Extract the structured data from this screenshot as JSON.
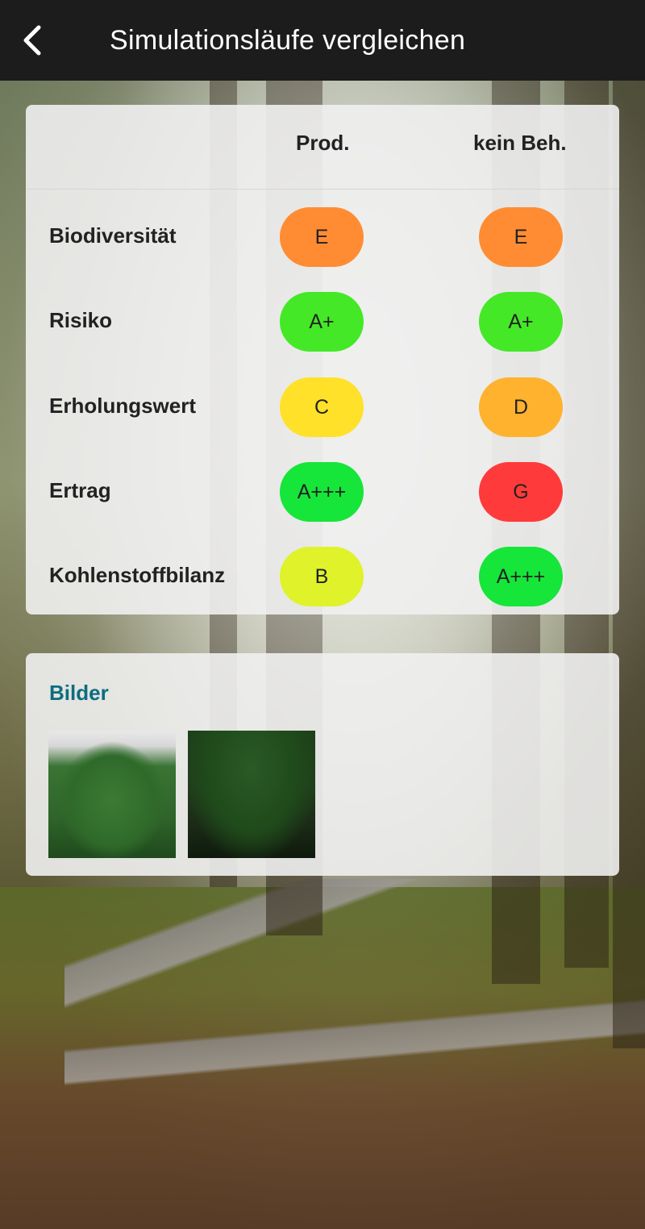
{
  "header": {
    "title": "Simulationsläufe vergleichen",
    "back_icon": "chevron-left-icon"
  },
  "comparison": {
    "columns": [
      "Prod.",
      "kein Beh."
    ],
    "rows": [
      {
        "label": "Biodiversität",
        "values": [
          {
            "grade": "E",
            "color": "#FF8C32"
          },
          {
            "grade": "E",
            "color": "#FF8C32"
          }
        ]
      },
      {
        "label": "Risiko",
        "values": [
          {
            "grade": "A+",
            "color": "#44E827"
          },
          {
            "grade": "A+",
            "color": "#44E827"
          }
        ]
      },
      {
        "label": "Erholungswert",
        "values": [
          {
            "grade": "C",
            "color": "#FFE12A"
          },
          {
            "grade": "D",
            "color": "#FFB22E"
          }
        ]
      },
      {
        "label": "Ertrag",
        "values": [
          {
            "grade": "A+++",
            "color": "#16E53A"
          },
          {
            "grade": "G",
            "color": "#FF3A3A"
          }
        ]
      },
      {
        "label": "Kohlenstoffbilanz",
        "values": [
          {
            "grade": "B",
            "color": "#DFF22A"
          },
          {
            "grade": "A+++",
            "color": "#16E53A"
          }
        ]
      }
    ]
  },
  "images": {
    "heading": "Bilder"
  }
}
